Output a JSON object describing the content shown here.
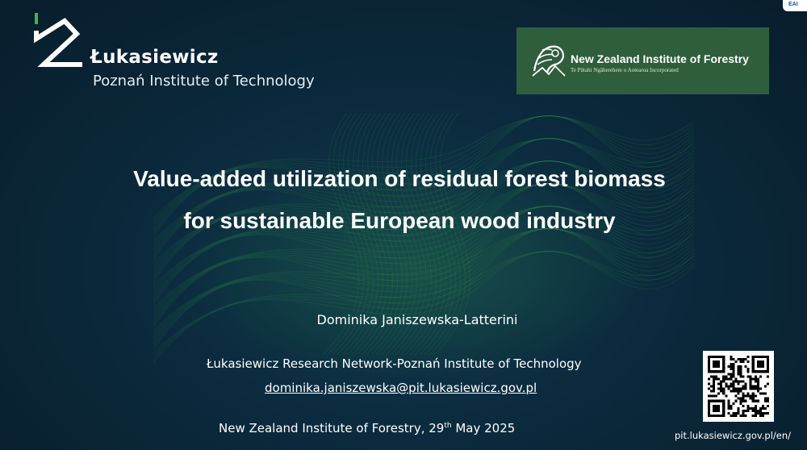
{
  "slide": {
    "background_color": "#0b2a3d",
    "accent_green": "#3fb34f"
  },
  "logos": {
    "lukasiewicz": {
      "name": "Łukasiewicz",
      "subtitle": "Poznań Institute of Technology",
      "icon": "lukasiewicz-mark-icon"
    },
    "nzif": {
      "name": "New Zealand Institute of Forestry",
      "subtitle": "Te Pūtahi Ngāherehere o Aotearoa Incorporated",
      "background_color": "#2f5e3d",
      "icon": "tree-emblem-icon"
    },
    "corner_badge": "EAI"
  },
  "title": {
    "line1": "Value-added utilization of residual forest biomass",
    "line2": "for sustainable European wood industry"
  },
  "author": "Dominika Janiszewska-Latterini",
  "affiliation": "Łukasiewicz Research Network-Poznań Institute of Technology",
  "email": "dominika.janiszewska@pit.lukasiewicz.gov.pl",
  "event": {
    "text": "New Zealand Institute of Forestry, 29",
    "ordinal": "th",
    "date_rest": " May 2025"
  },
  "qr": {
    "icon": "qr-code-icon",
    "url": "pit.lukasiewicz.gov.pl/en/"
  }
}
